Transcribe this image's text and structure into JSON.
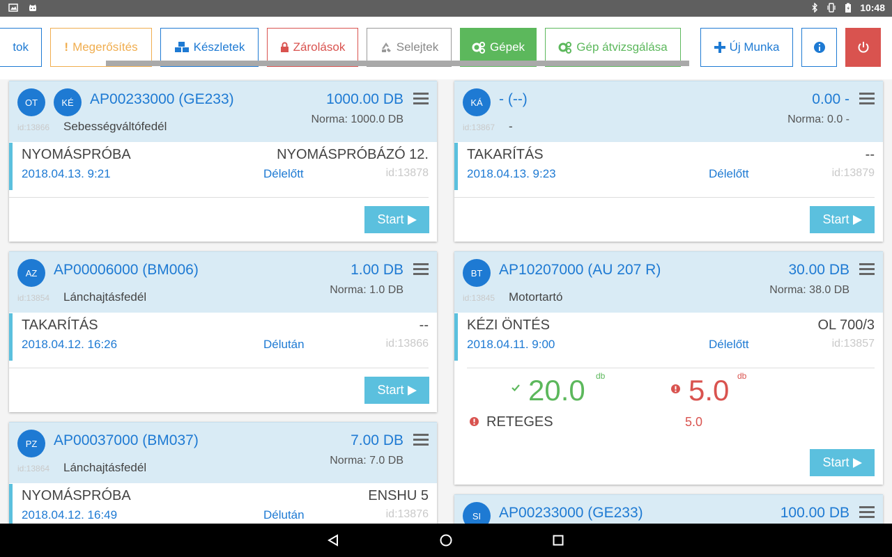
{
  "statusbar": {
    "time": "10:48"
  },
  "toolbar": {
    "buttons": [
      {
        "label": "tok"
      },
      {
        "label": "Megerősítés"
      },
      {
        "label": "Készletek"
      },
      {
        "label": "Zárolások"
      },
      {
        "label": "Selejtek"
      },
      {
        "label": "Gépek"
      },
      {
        "label": "Gép átvizsgálása"
      },
      {
        "label": "Új Munka"
      }
    ]
  },
  "start_label": "Start",
  "cards": [
    {
      "avatars": [
        "OT",
        "KÉ"
      ],
      "code": "AP00233000 (GE233)",
      "qty": "1000.00 DB",
      "norma": "Norma: 1000.0 DB",
      "id": "id:13866",
      "part": "Sebességváltófedél",
      "op": {
        "name": "NYOMÁSPRÓBA",
        "right": "NYOMÁSPRÓBÁZÓ 12.",
        "date": "2018.04.13. 9:21",
        "shift": "Délelőtt",
        "id": "id:13878"
      }
    },
    {
      "avatars": [
        "KÁ"
      ],
      "code": "- (--)",
      "qty": "0.00 -",
      "norma": "Norma: 0.0 -",
      "id": "id:13867",
      "part": "-",
      "op": {
        "name": "TAKARÍTÁS",
        "right": "--",
        "date": "2018.04.13. 9:23",
        "shift": "Délelőtt",
        "id": "id:13879"
      }
    },
    {
      "avatars": [
        "AZ"
      ],
      "code": "AP00006000 (BM006)",
      "qty": "1.00 DB",
      "norma": "Norma: 1.0 DB",
      "id": "id:13854",
      "part": "Lánchajtásfedél",
      "op": {
        "name": "TAKARÍTÁS",
        "right": "--",
        "date": "2018.04.12. 16:26",
        "shift": "Délután",
        "id": "id:13866"
      }
    },
    {
      "avatars": [
        "BT"
      ],
      "code": "AP10207000 (AU 207 R)",
      "qty": "30.00 DB",
      "norma": "Norma: 38.0 DB",
      "id": "id:13845",
      "part": "Motortartó",
      "op": {
        "name": "KÉZI ÖNTÉS",
        "right": "OL 700/3",
        "date": "2018.04.11. 9:00",
        "shift": "Délelőtt",
        "id": "id:13857"
      },
      "result": {
        "good": "20.0",
        "bad": "5.0",
        "unit": "db",
        "reason": "RETEGES",
        "reason_value": "5.0"
      }
    },
    {
      "avatars": [
        "PZ"
      ],
      "code": "AP00037000 (BM037)",
      "qty": "7.00 DB",
      "norma": "Norma: 7.0 DB",
      "id": "id:13864",
      "part": "Lánchajtásfedél",
      "op": {
        "name": "NYOMÁSPRÓBA",
        "right": "ENSHU 5",
        "date": "2018.04.12. 16:49",
        "shift": "Délután",
        "id": "id:13876"
      }
    },
    {
      "avatars": [
        "SI"
      ],
      "code": "AP00233000 (GE233)",
      "qty": "100.00 DB"
    }
  ]
}
